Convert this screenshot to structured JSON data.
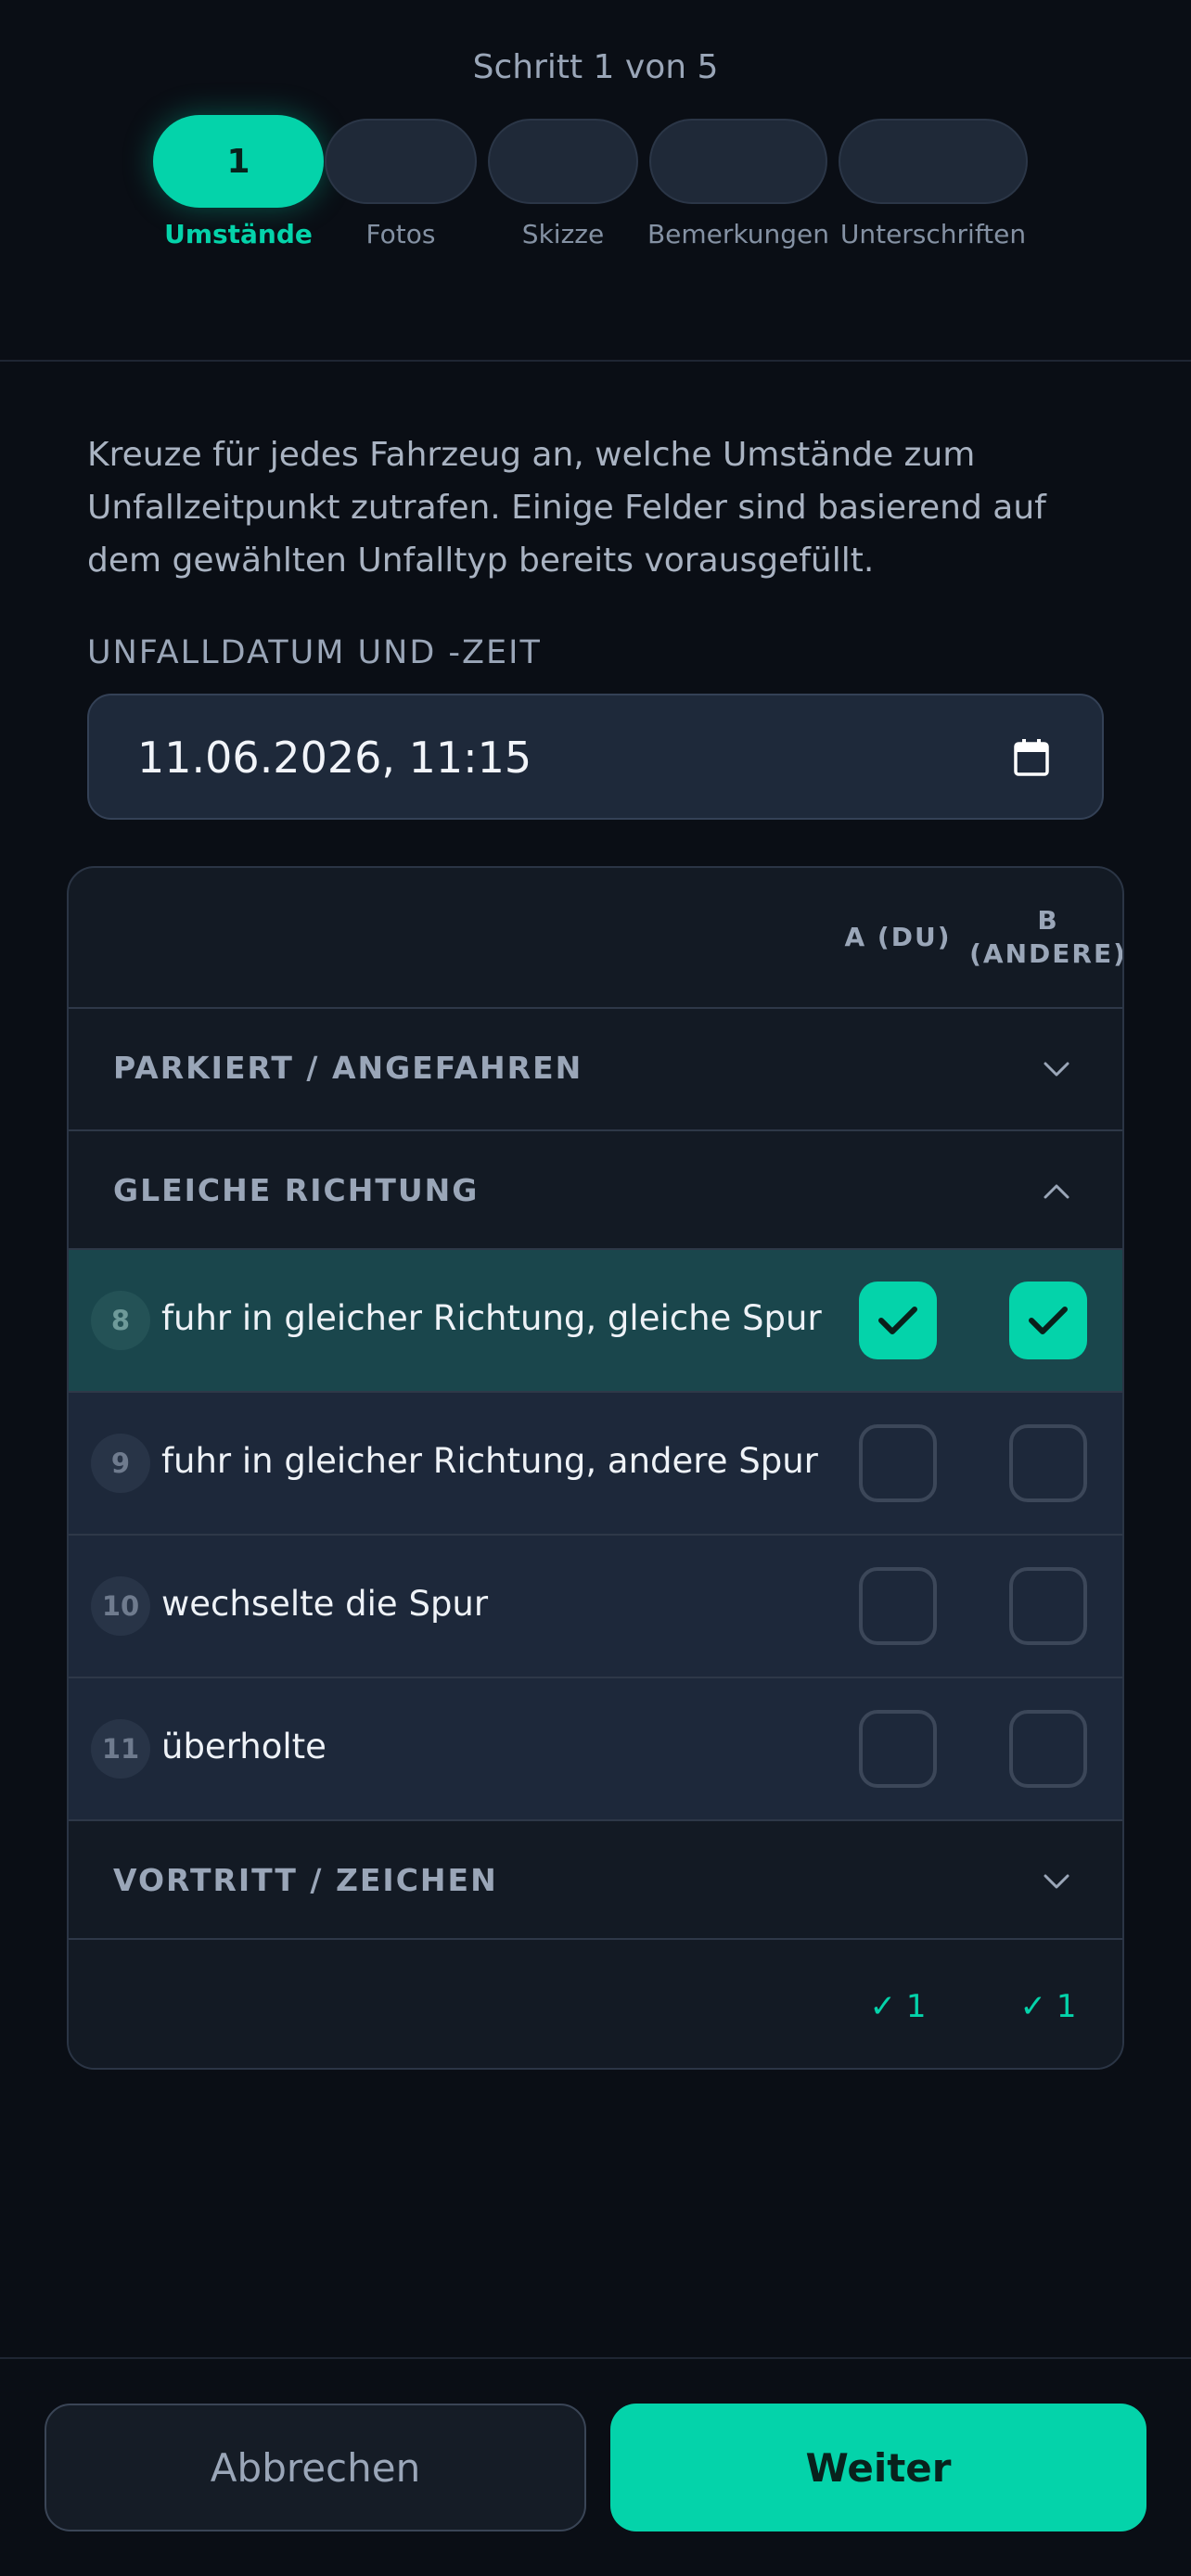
{
  "header": {
    "step_title": "Schritt 1 von 5",
    "steps": [
      {
        "number": "1",
        "label": "Umstände",
        "active": true
      },
      {
        "number": "",
        "label": "Fotos"
      },
      {
        "number": "",
        "label": "Skizze"
      },
      {
        "number": "",
        "label": "Bemerkungen"
      },
      {
        "number": "",
        "label": "Unterschriften"
      }
    ]
  },
  "intro": "Kreuze für jedes Fahrzeug an, welche Umstände zum Unfallzeitpunkt zutrafen. Einige Felder sind basierend auf dem gewählten Unfalltyp bereits vorausgefüllt.",
  "date": {
    "label": "UNFALLDATUM UND -ZEIT",
    "value": "11.06.2026, 11:15",
    "icon": "calendar-icon"
  },
  "table": {
    "col_a": "A (DU)",
    "col_b": "B (ANDERE)",
    "sections": [
      {
        "title": "PARKIERT / ANGEFAHREN",
        "expanded": false
      },
      {
        "title": "GLEICHE RICHTUNG",
        "expanded": true
      },
      {
        "title": "VORTRITT / ZEICHEN",
        "expanded": false
      }
    ],
    "items": [
      {
        "number": "8",
        "label": "fuhr in gleicher Richtung, gleiche Spur",
        "a": true,
        "b": true
      },
      {
        "number": "9",
        "label": "fuhr in gleicher Richtung, andere Spur",
        "a": false,
        "b": false
      },
      {
        "number": "10",
        "label": "wechselte die Spur",
        "a": false,
        "b": false
      },
      {
        "number": "11",
        "label": "überholte",
        "a": false,
        "b": false
      }
    ],
    "count_a": "✓ 1",
    "count_b": "✓ 1"
  },
  "actions": {
    "cancel": "Abbrechen",
    "next": "Weiter"
  },
  "colors": {
    "accent": "#04d3aa",
    "background": "#0a0e15",
    "row": "#1d283a",
    "row_selected": "#1a464c"
  }
}
